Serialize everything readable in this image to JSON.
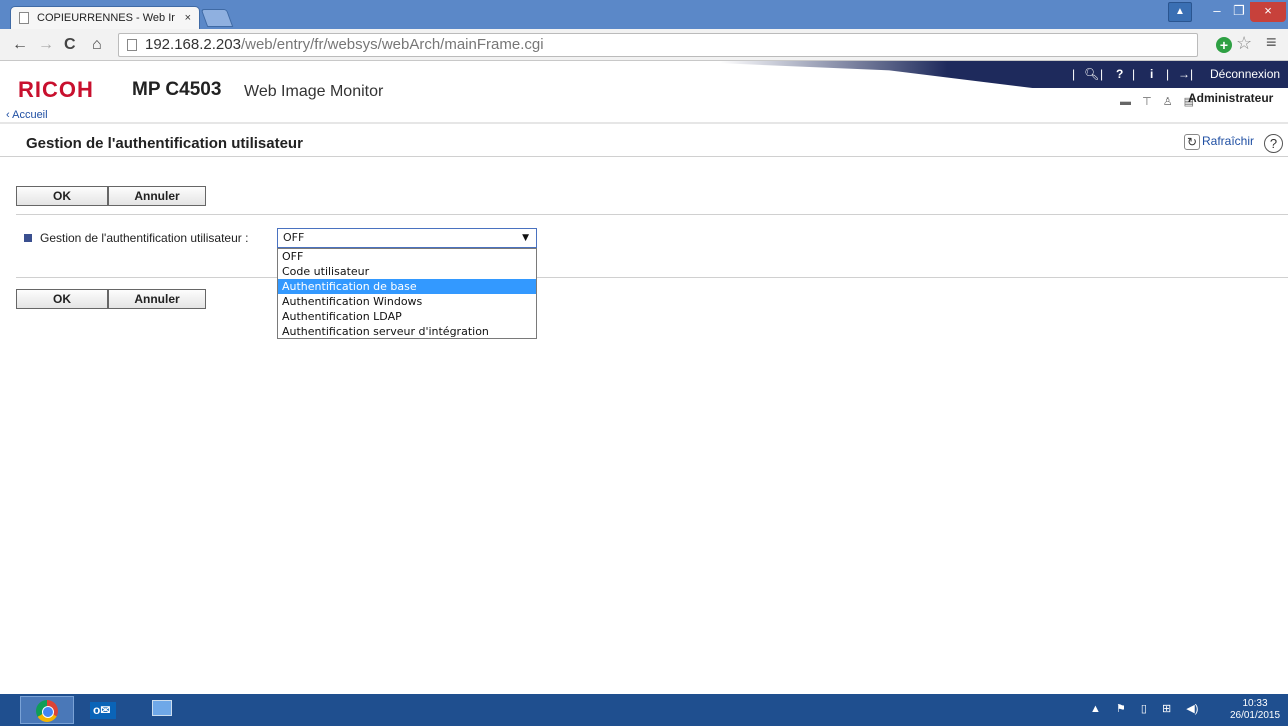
{
  "browser": {
    "tab_title": "COPIEURRENNES - Web Ir",
    "tab_close": "×",
    "url_host": "192.168.2.203",
    "url_path": "/web/entry/fr/websys/webArch/mainFrame.cgi",
    "win_min": "–",
    "win_max": "❐",
    "win_close": "×"
  },
  "header": {
    "brand": "RICOH",
    "model": "MP C4503",
    "product": "Web Image Monitor",
    "logout": "Déconnexion",
    "user": "Administrateur",
    "breadcrumb": "‹ Accueil"
  },
  "page": {
    "title": "Gestion de l'authentification utilisateur",
    "refresh": "Rafraîchir"
  },
  "form": {
    "ok": "OK",
    "cancel": "Annuler",
    "field_label": "Gestion de l'authentification utilisateur :",
    "selected": "OFF",
    "options": [
      "OFF",
      "Code utilisateur",
      "Authentification de base",
      "Authentification Windows",
      "Authentification LDAP",
      "Authentification serveur d'intégration"
    ],
    "highlighted_index": 2
  },
  "taskbar": {
    "time": "10:33",
    "date": "26/01/2015"
  },
  "colors": {
    "brand_red": "#c8102e",
    "highlight": "#3399ff",
    "header_navy": "#1e2a5c",
    "taskbar": "#1f4f8f"
  }
}
